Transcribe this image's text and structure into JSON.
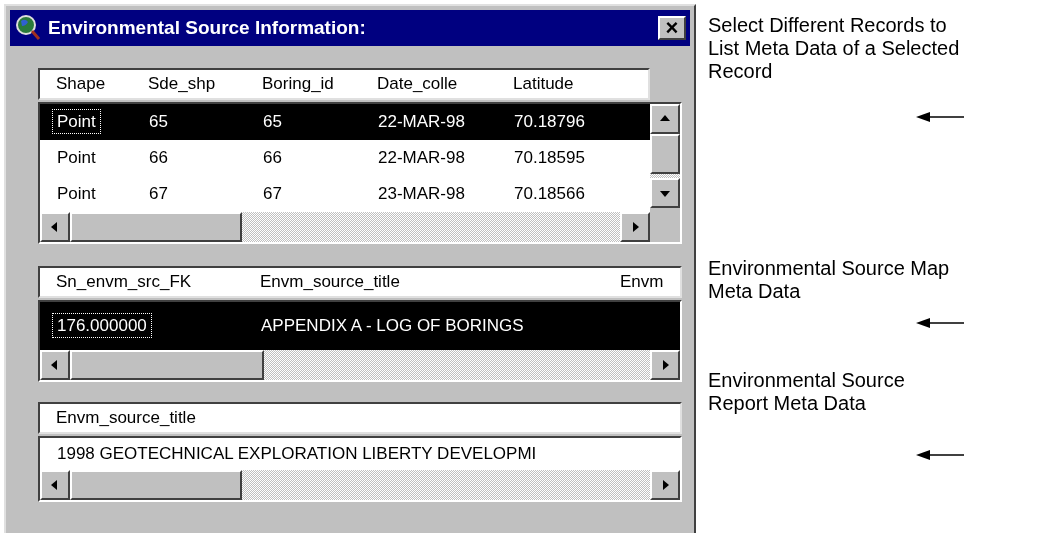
{
  "window": {
    "title": "Environmental Source Information:",
    "close": "×"
  },
  "records_grid": {
    "columns": [
      "Shape",
      "Sde_shp",
      "Boring_id",
      "Date_colle",
      "Latitude"
    ],
    "rows": [
      {
        "cells": [
          "Point",
          "65",
          "65",
          "22-MAR-98",
          "70.18796"
        ],
        "selected": true
      },
      {
        "cells": [
          "Point",
          "66",
          "66",
          "22-MAR-98",
          "70.18595"
        ],
        "selected": false
      },
      {
        "cells": [
          "Point",
          "67",
          "67",
          "23-MAR-98",
          "70.18566"
        ],
        "selected": false
      }
    ]
  },
  "map_grid": {
    "columns": [
      "Sn_envm_src_FK",
      "Envm_source_title",
      "Envm"
    ],
    "rows": [
      {
        "cells": [
          "176.000000",
          "APPENDIX A - LOG OF BORINGS"
        ],
        "selected": true
      }
    ]
  },
  "report_grid": {
    "columns": [
      "Envm_source_title"
    ],
    "rows": [
      {
        "cells": [
          "1998 GEOTECHNICAL EXPLORATION LIBERTY DEVELOPMI"
        ],
        "selected": false
      }
    ]
  },
  "annotations": [
    {
      "lines": [
        "Select Different Records to",
        "List Meta Data of a Selected",
        "Record"
      ]
    },
    {
      "lines": [
        "Environmental Source Map",
        "Meta Data"
      ]
    },
    {
      "lines": [
        "Environmental Source",
        "Report Meta Data"
      ]
    }
  ]
}
